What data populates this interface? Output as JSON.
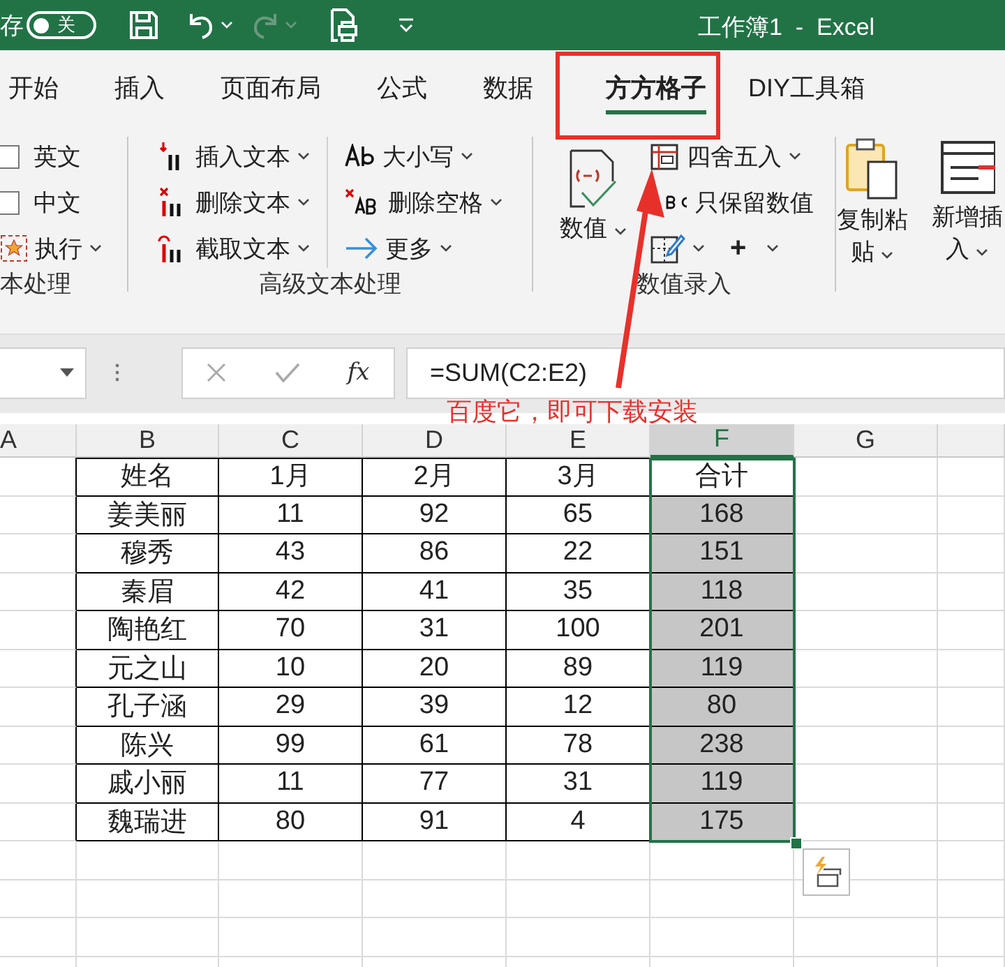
{
  "title_bar": {
    "autosave_label": "存",
    "autosave": {
      "label": "关",
      "on": false
    },
    "title": "工作簿1  -  Excel"
  },
  "tabs": [
    {
      "label": "开始",
      "selected": false
    },
    {
      "label": "插入",
      "selected": false
    },
    {
      "label": "页面布局",
      "selected": false
    },
    {
      "label": "公式",
      "selected": false
    },
    {
      "label": "数据",
      "selected": false
    },
    {
      "label": "方方格子",
      "selected": true
    },
    {
      "label": "DIY工具箱",
      "selected": false
    }
  ],
  "ribbon": {
    "groups": [
      {
        "label": "本处理",
        "columns": [
          [
            {
              "kind": "check",
              "label": "英文",
              "checked": false
            },
            {
              "kind": "check",
              "label": "中文",
              "checked": false
            },
            {
              "kind": "menu",
              "label": "执行"
            }
          ]
        ]
      },
      {
        "label": "高级文本处理",
        "columns": [
          [
            {
              "kind": "menu",
              "label": "插入文本"
            },
            {
              "kind": "menu",
              "label": "删除文本"
            },
            {
              "kind": "menu",
              "label": "截取文本"
            }
          ],
          [
            {
              "kind": "menu",
              "label": "大小写"
            },
            {
              "kind": "menu",
              "label": "删除空格"
            },
            {
              "kind": "menu",
              "label": "更多"
            }
          ]
        ]
      },
      {
        "label": "数值录入",
        "columns": [
          [
            {
              "kind": "large",
              "label": "数值"
            }
          ],
          [
            {
              "kind": "menu",
              "label": "四舍五入"
            },
            {
              "kind": "button",
              "label": "只保留数值"
            },
            {
              "kind": "row",
              "items": [
                {
                  "kind": "icon_menu"
                },
                {
                  "kind": "icon_menu",
                  "symbol": "+"
                }
              ]
            }
          ]
        ]
      },
      {
        "columns": [
          [
            {
              "kind": "large",
              "label": "复制粘贴"
            }
          ],
          [
            {
              "kind": "large",
              "label": "新增插入"
            }
          ]
        ]
      }
    ]
  },
  "formula_bar": {
    "function_label": "fx",
    "formula": "=SUM(C2:E2)"
  },
  "sheet": {
    "columns": [
      {
        "label": "A",
        "selected": false
      },
      {
        "label": "B",
        "selected": false
      },
      {
        "label": "C",
        "selected": false
      },
      {
        "label": "D",
        "selected": false
      },
      {
        "label": "E",
        "selected": false
      },
      {
        "label": "F",
        "selected": true
      },
      {
        "label": "G",
        "selected": false
      }
    ],
    "rows": [
      {
        "cells": [
          "",
          "姓名",
          "1月",
          "2月",
          "3月",
          "合计",
          ""
        ],
        "selected": false
      },
      {
        "cells": [
          "",
          "姜美丽",
          "11",
          "92",
          "65",
          "168",
          ""
        ],
        "selected": true
      },
      {
        "cells": [
          "",
          "穆秀",
          "43",
          "86",
          "22",
          "151",
          ""
        ],
        "selected": true
      },
      {
        "cells": [
          "",
          "秦眉",
          "42",
          "41",
          "35",
          "118",
          ""
        ],
        "selected": true
      },
      {
        "cells": [
          "",
          "陶艳红",
          "70",
          "31",
          "100",
          "201",
          ""
        ],
        "selected": true
      },
      {
        "cells": [
          "",
          "元之山",
          "10",
          "20",
          "89",
          "119",
          ""
        ],
        "selected": true
      },
      {
        "cells": [
          "",
          "孔子涵",
          "29",
          "39",
          "12",
          "80",
          ""
        ],
        "selected": true
      },
      {
        "cells": [
          "",
          "陈兴",
          "99",
          "61",
          "78",
          "238",
          ""
        ],
        "selected": true
      },
      {
        "cells": [
          "",
          "戚小丽",
          "11",
          "77",
          "31",
          "119",
          ""
        ],
        "selected": true
      },
      {
        "cells": [
          "",
          "魏瑞进",
          "80",
          "91",
          "4",
          "175",
          ""
        ],
        "selected": true
      }
    ]
  },
  "annotation": {
    "text": "百度它，即可下载安装"
  }
}
